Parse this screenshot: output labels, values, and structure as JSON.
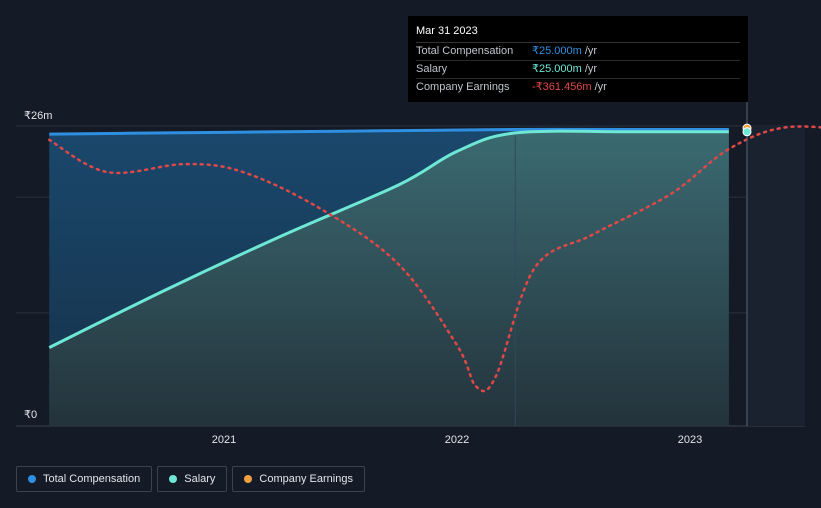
{
  "chart_data": {
    "type": "area",
    "x_ticks": [
      "2021",
      "2022",
      "2023"
    ],
    "y_ticks": [
      "₹0",
      "₹26m"
    ],
    "ylim": [
      0,
      26
    ],
    "grid": true,
    "series": [
      {
        "name": "Total Compensation",
        "color": "#2f8fe0",
        "points": [
          [
            "2020-04",
            25.3
          ],
          [
            "2020-10",
            25.4
          ],
          [
            "2021-04",
            25.5
          ],
          [
            "2021-10",
            25.6
          ],
          [
            "2022-04",
            25.7
          ],
          [
            "2022-10",
            25.7
          ],
          [
            "2023-03",
            25.7
          ]
        ]
      },
      {
        "name": "Salary",
        "color": "#6ee7d5",
        "points": [
          [
            "2020-04",
            6.8
          ],
          [
            "2020-10",
            11.8
          ],
          [
            "2021-04",
            16.5
          ],
          [
            "2021-10",
            20.9
          ],
          [
            "2022-01",
            23.8
          ],
          [
            "2022-04",
            25.4
          ],
          [
            "2022-10",
            25.5
          ],
          [
            "2023-03",
            25.5
          ]
        ]
      },
      {
        "name": "Company Earnings",
        "color": "#e04848",
        "dashed": true,
        "points": [
          [
            "2020-04",
            24.8
          ],
          [
            "2020-07",
            22.0
          ],
          [
            "2020-11",
            22.7
          ],
          [
            "2021-02",
            22.0
          ],
          [
            "2021-06",
            18.8
          ],
          [
            "2021-10",
            14.0
          ],
          [
            "2022-01",
            7.0
          ],
          [
            "2022-02",
            3.4
          ],
          [
            "2022-03",
            4.3
          ],
          [
            "2022-05",
            13.7
          ],
          [
            "2022-08",
            16.6
          ],
          [
            "2022-12",
            20.1
          ],
          [
            "2023-03",
            24.0
          ],
          [
            "2023-06",
            25.9
          ],
          [
            "2023-10",
            25.5
          ]
        ]
      }
    ]
  },
  "tooltip": {
    "date": "Mar 31 2023",
    "rows": [
      {
        "label": "Total Compensation",
        "value": "₹25.000m",
        "unit": "/yr",
        "color": "#2f8fe0"
      },
      {
        "label": "Salary",
        "value": "₹25.000m",
        "unit": "/yr",
        "color": "#6ee7d5"
      },
      {
        "label": "Company Earnings",
        "value": "-₹361.456m",
        "unit": "/yr",
        "color": "#e04848"
      }
    ]
  },
  "legend": {
    "items": [
      {
        "label": "Total Compensation",
        "color": "#2f8fe0"
      },
      {
        "label": "Salary",
        "color": "#6ee7d5"
      },
      {
        "label": "Company Earnings",
        "color": "#f0a040"
      }
    ]
  }
}
